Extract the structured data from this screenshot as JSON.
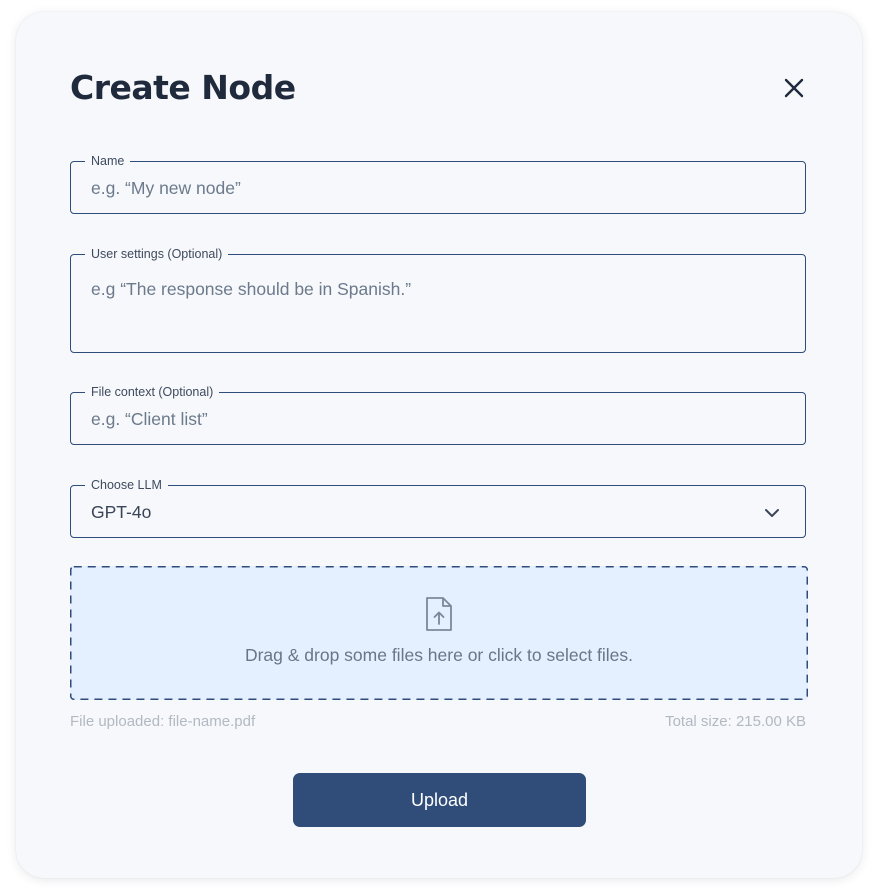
{
  "dialog": {
    "title": "Create Node",
    "close_icon": "close-icon"
  },
  "fields": {
    "name": {
      "label": "Name",
      "placeholder": "e.g. “My new node”"
    },
    "user_settings": {
      "label": "User settings (Optional)",
      "placeholder": "e.g “The response should be in Spanish.”"
    },
    "file_context": {
      "label": "File context (Optional)",
      "placeholder": "e.g. “Client list”"
    },
    "llm": {
      "label": "Choose LLM",
      "value": "GPT-4o",
      "icon": "chevron-down-icon"
    }
  },
  "dropzone": {
    "icon": "file-upload-icon",
    "text": "Drag & drop some files here or click to select files."
  },
  "upload_info": {
    "file_uploaded": "File uploaded: file-name.pdf",
    "total_size": "Total size: 215.00 KB"
  },
  "actions": {
    "upload_label": "Upload"
  },
  "colors": {
    "primary": "#2f4d78",
    "dropzone_bg": "#e4efff",
    "modal_bg": "#f6f8fb",
    "title": "#1f2a3d"
  }
}
